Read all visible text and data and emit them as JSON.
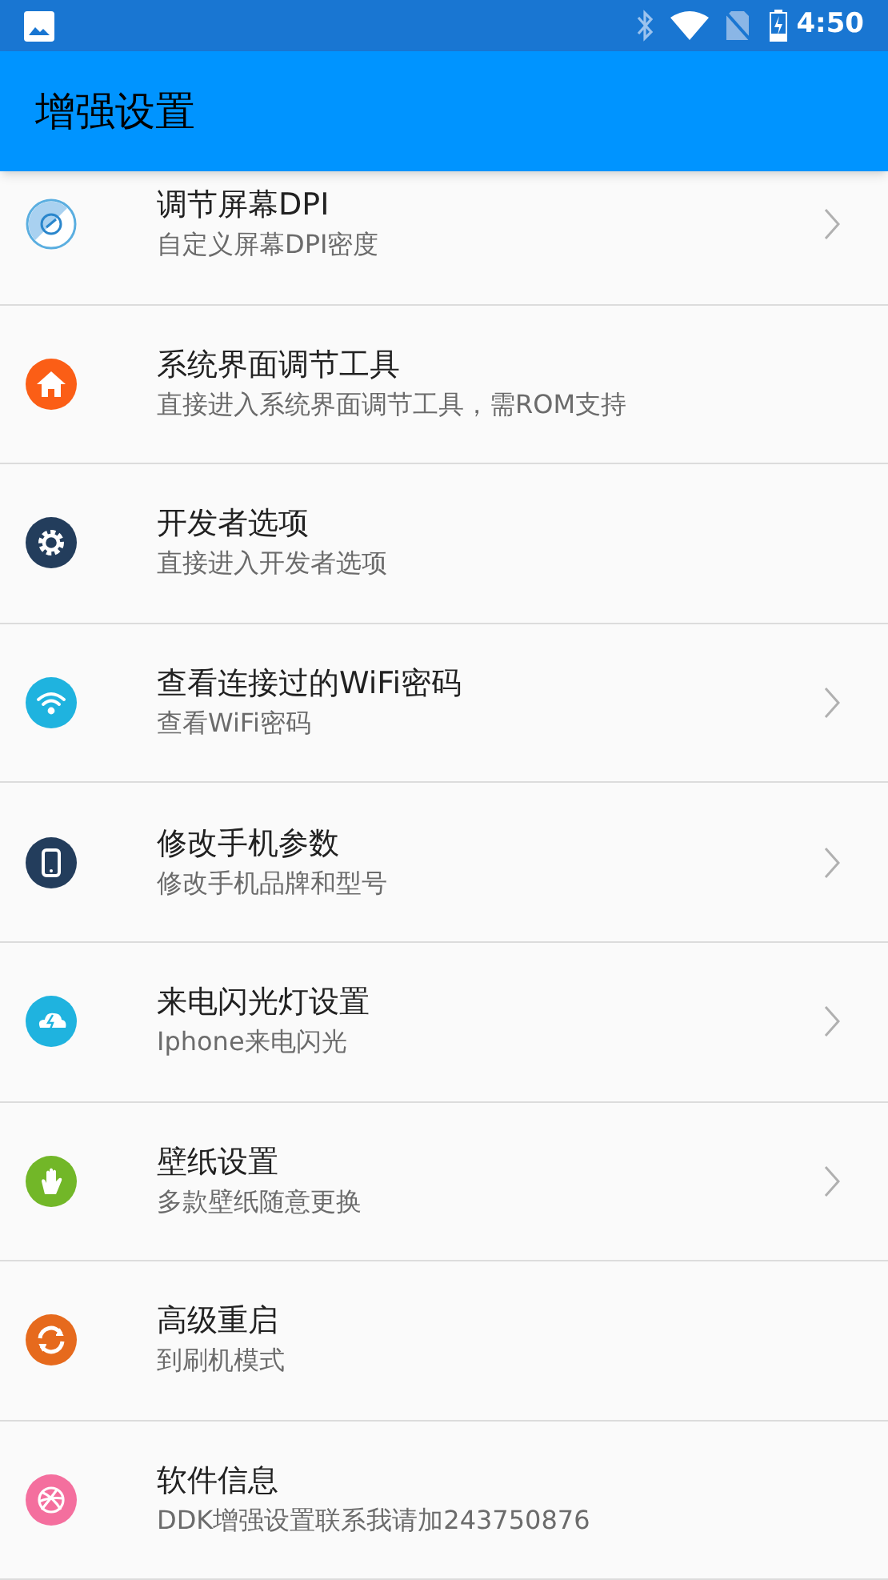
{
  "status_bar": {
    "time": "4:50"
  },
  "app_bar": {
    "title": "增强设置"
  },
  "items": [
    {
      "title": "调节屏幕DPI",
      "subtitle": "自定义屏幕DPI密度",
      "kind": "disc",
      "color": "#5aaee0",
      "chevron": true
    },
    {
      "title": "系统界面调节工具",
      "subtitle": "直接进入系统界面调节工具，需ROM支持",
      "kind": "home",
      "color": "#fb5e16",
      "chevron": false
    },
    {
      "title": "开发者选项",
      "subtitle": "直接进入开发者选项",
      "kind": "gear",
      "color": "#233d5c",
      "chevron": false
    },
    {
      "title": "查看连接过的WiFi密码",
      "subtitle": "查看WiFi密码",
      "kind": "wifi",
      "color": "#1fb3df",
      "chevron": true
    },
    {
      "title": "修改手机参数",
      "subtitle": "修改手机品牌和型号",
      "kind": "phone",
      "color": "#233d5c",
      "chevron": true
    },
    {
      "title": "来电闪光灯设置",
      "subtitle": "Iphone来电闪光",
      "kind": "cloud",
      "color": "#1fb3df",
      "chevron": true
    },
    {
      "title": "壁纸设置",
      "subtitle": "多款壁纸随意更换",
      "kind": "hand",
      "color": "#72b728",
      "chevron": true
    },
    {
      "title": "高级重启",
      "subtitle": "到刷机模式",
      "kind": "refresh",
      "color": "#e66a1d",
      "chevron": false
    },
    {
      "title": "软件信息",
      "subtitle": "DDK增强设置联系我请加243750876",
      "kind": "ball",
      "color": "#f46f9e",
      "chevron": false
    }
  ]
}
